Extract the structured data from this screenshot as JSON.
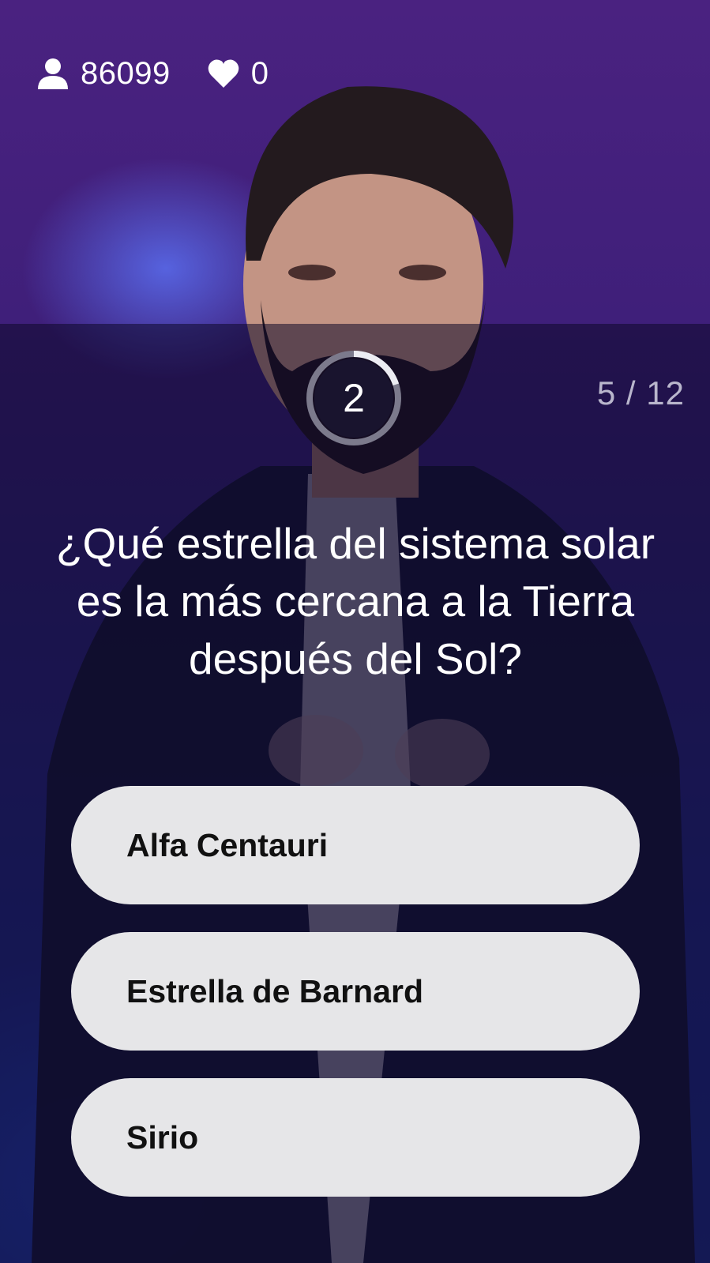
{
  "stats": {
    "viewers": "86099",
    "lives": "0"
  },
  "timer": {
    "seconds": "2",
    "fraction_remaining": 0.2
  },
  "progress": "5 / 12",
  "question": "¿Qué estrella del sistema solar es la más cercana a la Tierra después del Sol?",
  "answers": [
    {
      "label": "Alfa Centauri"
    },
    {
      "label": "Estrella de Barnard"
    },
    {
      "label": "Sirio"
    }
  ],
  "icons": {
    "viewers": "person-icon",
    "lives": "heart-icon"
  },
  "colors": {
    "background_top": "#4a2280",
    "background_bottom": "#1d2f8a",
    "answer_bg": "#e6e6e8",
    "text": "#ffffff",
    "progress_text": "#b9b6cc"
  }
}
